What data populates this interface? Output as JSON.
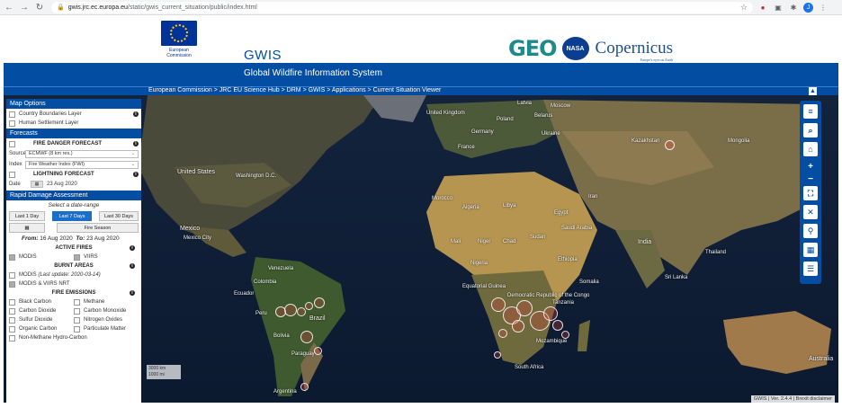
{
  "browser": {
    "url_host": "gwis.jrc.ec.europa.eu",
    "url_path": "/static/gwis_current_situation/public/index.html",
    "profile_initial": "J"
  },
  "header": {
    "ec_label_1": "European",
    "ec_label_2": "Commission",
    "title": "GWIS",
    "subtitle": "Global Wildfire Information System",
    "geo_logo": "GEO",
    "nasa_logo": "NASA",
    "copernicus_logo": "opernicus",
    "copernicus_c": "C",
    "copernicus_tagline": "Europe's eyes on Earth",
    "breadcrumb": "European Commission > JRC EU Science Hub > DRM > GWIS > Applications > Current Situation Viewer"
  },
  "panel": {
    "map_options": {
      "title": "Map Options",
      "layers": [
        "Country Boundaries Layer",
        "Human Settlement Layer"
      ]
    },
    "forecasts": {
      "title": "Forecasts",
      "fire_danger_label": "FIRE DANGER FORECAST",
      "source_label": "Source",
      "source_value": "ECMWF (8 km res.)",
      "index_label": "Index",
      "index_value": "Fire Weather Index (FWI)",
      "lightning_label": "LIGHTNING FORECAST",
      "date_label": "Date",
      "date_value": "23 Aug 2020"
    },
    "rapid": {
      "title": "Rapid Damage Assessment",
      "select_range": "Select a date-range",
      "btn_1day": "Last 1 Day",
      "btn_7days": "Last 7 Days",
      "btn_30days": "Last 30 Days",
      "btn_fire_season": "Fire Season",
      "from_label": "From:",
      "from_value": "16 Aug 2020",
      "to_label": "To:",
      "to_value": "23 Aug 2020",
      "active_fires_label": "ACTIVE FIRES",
      "modis_label": "MODIS",
      "viirs_label": "VIIRS",
      "burnt_areas_label": "BURNT AREAS",
      "burnt_modis_label": "MODIS",
      "burnt_modis_update": "(Last update: 2020-03-14)",
      "burnt_modis_viirs_label": "MODIS & VIIRS NRT",
      "fire_emissions_label": "FIRE EMISSIONS",
      "emissions": [
        "Black Carbon",
        "Methane",
        "Carbon Dioxide",
        "Carbon Monoxide",
        "Sulfur Dioxide",
        "Nitrogen Oxides",
        "Organic Carbon",
        "Particulate Matter"
      ],
      "emission_last": "Non-Methane Hydro-Carbon"
    }
  },
  "map": {
    "labels": {
      "uk": "United Kingdom",
      "latvia": "Latvia",
      "moscow": "Moscow",
      "belarus": "Belarus",
      "poland": "Poland",
      "ukraine": "Ukraine",
      "germany": "Germany",
      "france": "France",
      "kazakhstan": "Kazakhstan",
      "mongolia": "Mongolia",
      "usa": "United States",
      "washington": "Washington D.C.",
      "morocco": "Morocco",
      "algeria": "Algeria",
      "libya": "Libya",
      "egypt": "Egypt",
      "mali": "Mali",
      "niger": "Niger",
      "chad": "Chad",
      "sudan": "Sudan",
      "nigeria": "Nigeria",
      "ethiopia": "Ethiopia",
      "equatorial_guinea": "Equatorial Guinea",
      "drc": "Democratic Republic of the Congo",
      "tanzania": "Tanzania",
      "mozambique": "Mozambique",
      "south_africa": "South Africa",
      "mexico": "Mexico",
      "mexico_city": "Mexico City",
      "venezuela": "Venezuela",
      "colombia": "Colombia",
      "ecuador": "Ecuador",
      "peru": "Peru",
      "brazil": "Brazil",
      "bolivia": "Bolivia",
      "paraguay": "Paraguay",
      "argentina": "Argentina",
      "india": "India",
      "sri_lanka": "Sri Lanka",
      "thailand": "Thailand",
      "iran": "Iran",
      "saudi": "Saudi Arabia",
      "australia": "Australia",
      "somalia": "Somalia"
    },
    "scale_1": "3000 km",
    "scale_2": "1000 mi",
    "attribution": "GWIS | Ver. 2.4.4 | Brexit disclaimer"
  },
  "toolbar": {
    "menu_icon": "≡",
    "search_icon": "⌕",
    "home_icon": "⌂",
    "zoom_in": "+",
    "zoom_out": "−",
    "fullscreen_icon": "⛶",
    "close_icon": "✕",
    "location_icon": "⚲",
    "grid_icon": "▦",
    "list_icon": "☰"
  },
  "colors": {
    "brand_blue": "#034ea2",
    "active_button": "#1c6fc9"
  }
}
